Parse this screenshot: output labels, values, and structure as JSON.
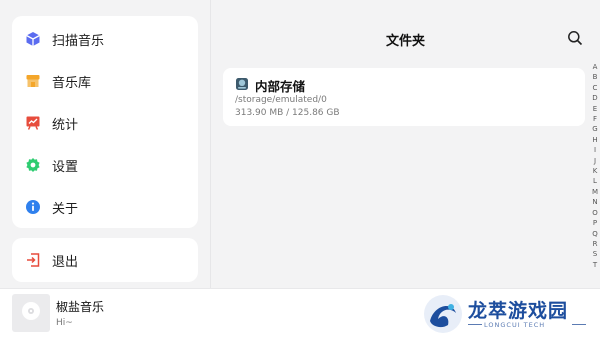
{
  "sidebar": {
    "items": [
      {
        "label": "扫描音乐",
        "icon": "scan-music-cube-icon",
        "color": "#5b6cf0"
      },
      {
        "label": "音乐库",
        "icon": "music-library-store-icon",
        "color": "#f4a62a"
      },
      {
        "label": "统计",
        "icon": "statistics-chart-icon",
        "color": "#e74c3c"
      },
      {
        "label": "设置",
        "icon": "settings-gear-icon",
        "color": "#2ecc71"
      },
      {
        "label": "关于",
        "icon": "info-icon",
        "color": "#2f80ed"
      }
    ],
    "exit": {
      "label": "退出",
      "icon": "exit-icon",
      "color": "#e74c3c"
    }
  },
  "header": {
    "title": "文件夹",
    "search_icon": "search-icon"
  },
  "storage": {
    "name": "内部存储",
    "path": "/storage/emulated/0",
    "size": "313.90 MB / 125.86 GB",
    "icon": "hard-drive-icon"
  },
  "alphabet": [
    "A",
    "B",
    "C",
    "D",
    "E",
    "F",
    "G",
    "H",
    "I",
    "J",
    "K",
    "L",
    "M",
    "N",
    "O",
    "P",
    "Q",
    "R",
    "S",
    "T"
  ],
  "player": {
    "title": "椒盐音乐",
    "subtitle": "Hi~",
    "icon": "album-disc-icon"
  },
  "watermark": {
    "brand": "龙萃游戏园",
    "sub": "LONGCUI TECH"
  }
}
